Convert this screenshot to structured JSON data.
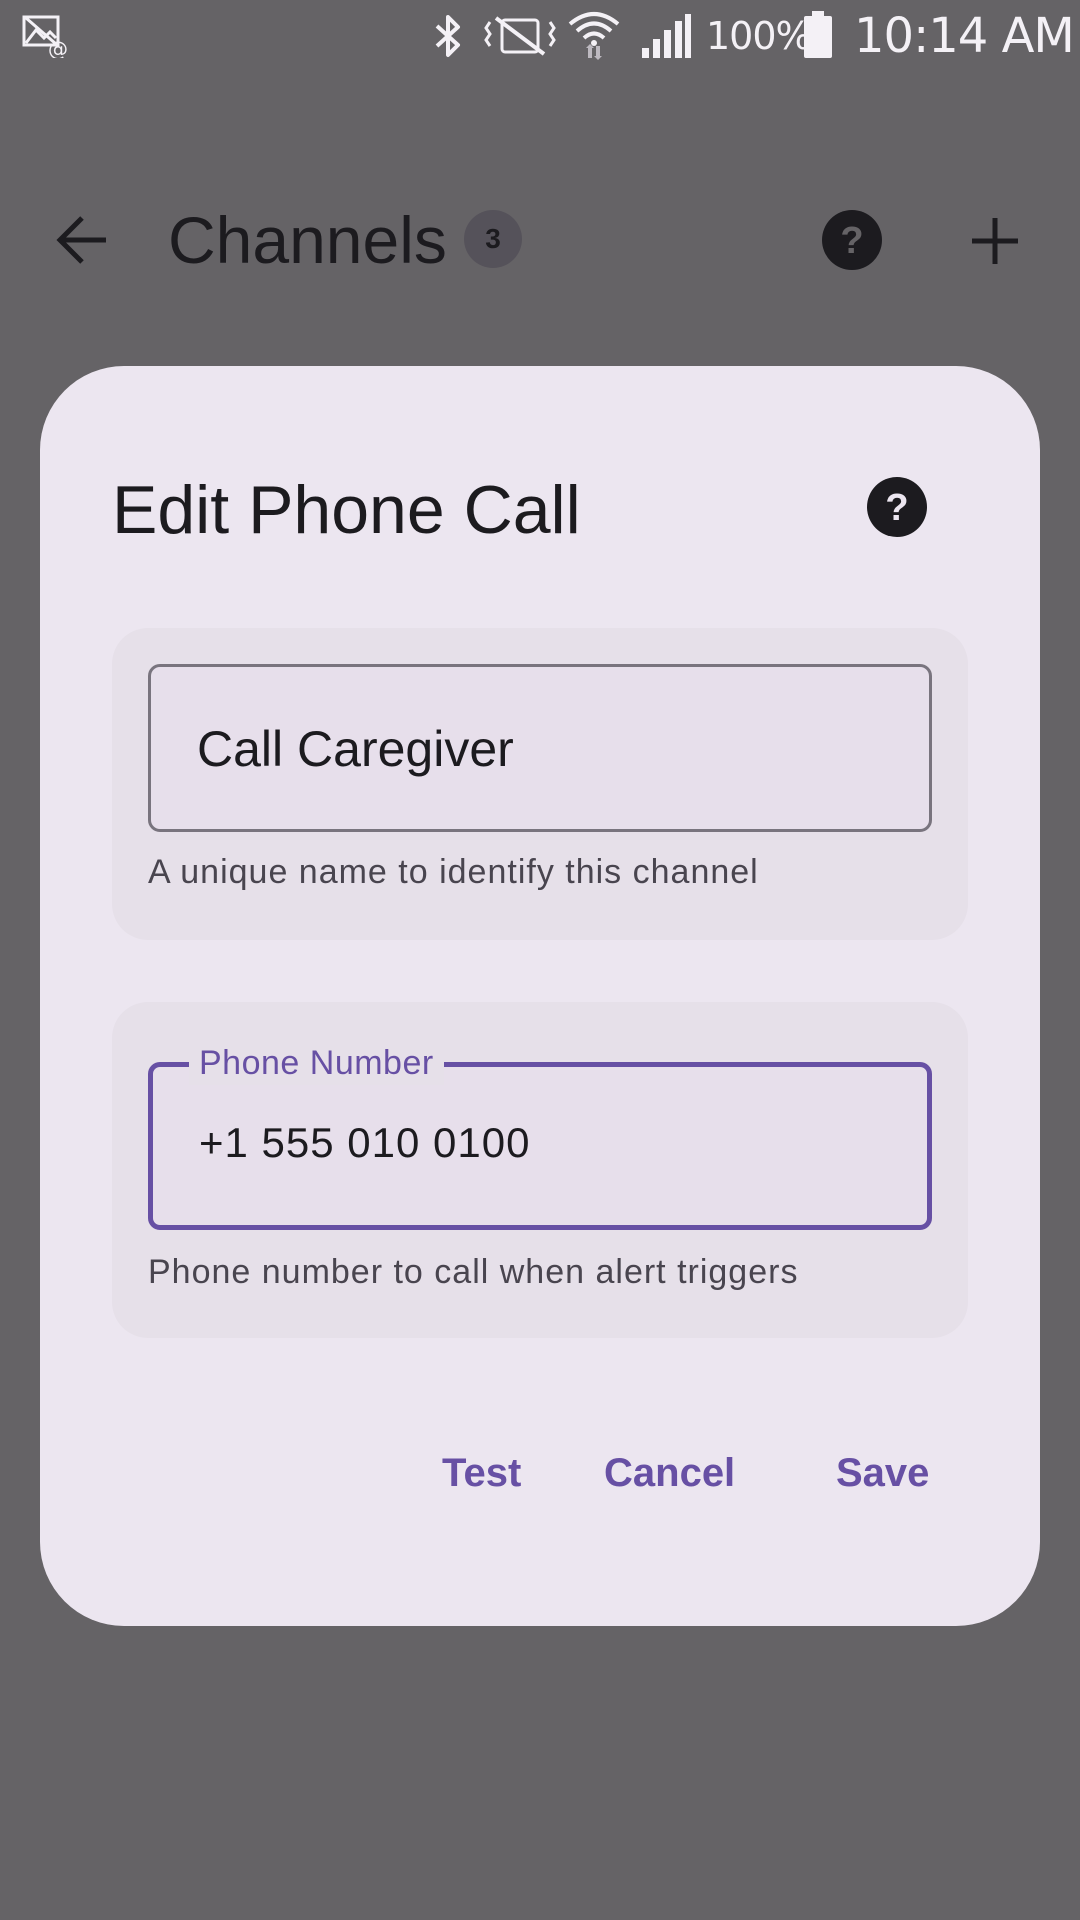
{
  "status_bar": {
    "battery_percent": "100%",
    "time": "10:14 AM",
    "icons": [
      "notification-icon",
      "bluetooth-icon",
      "vibrate-mute-icon",
      "wifi-icon",
      "cellular-signal-icon",
      "battery-icon"
    ]
  },
  "app_bar": {
    "title": "Channels",
    "count_badge": "3",
    "icons": [
      "back-arrow-icon",
      "help-icon",
      "plus-icon"
    ]
  },
  "dialog": {
    "title": "Edit Phone Call",
    "name_field": {
      "value": "Call Caregiver",
      "supporting_text": "A unique name to identify this channel"
    },
    "phone_field": {
      "label": "Phone Number",
      "value": "+1 555 010 0100",
      "supporting_text": "Phone number to call when alert triggers"
    },
    "actions": {
      "test": "Test",
      "cancel": "Cancel",
      "save": "Save"
    }
  },
  "colors": {
    "scrim": "#656366",
    "dialog_surface": "#ece6f0",
    "card_surface": "#e6e0e9",
    "primary": "#6750a4",
    "on_surface": "#1c1b1f",
    "on_surface_variant": "#49454f",
    "outline": "#79747e"
  }
}
